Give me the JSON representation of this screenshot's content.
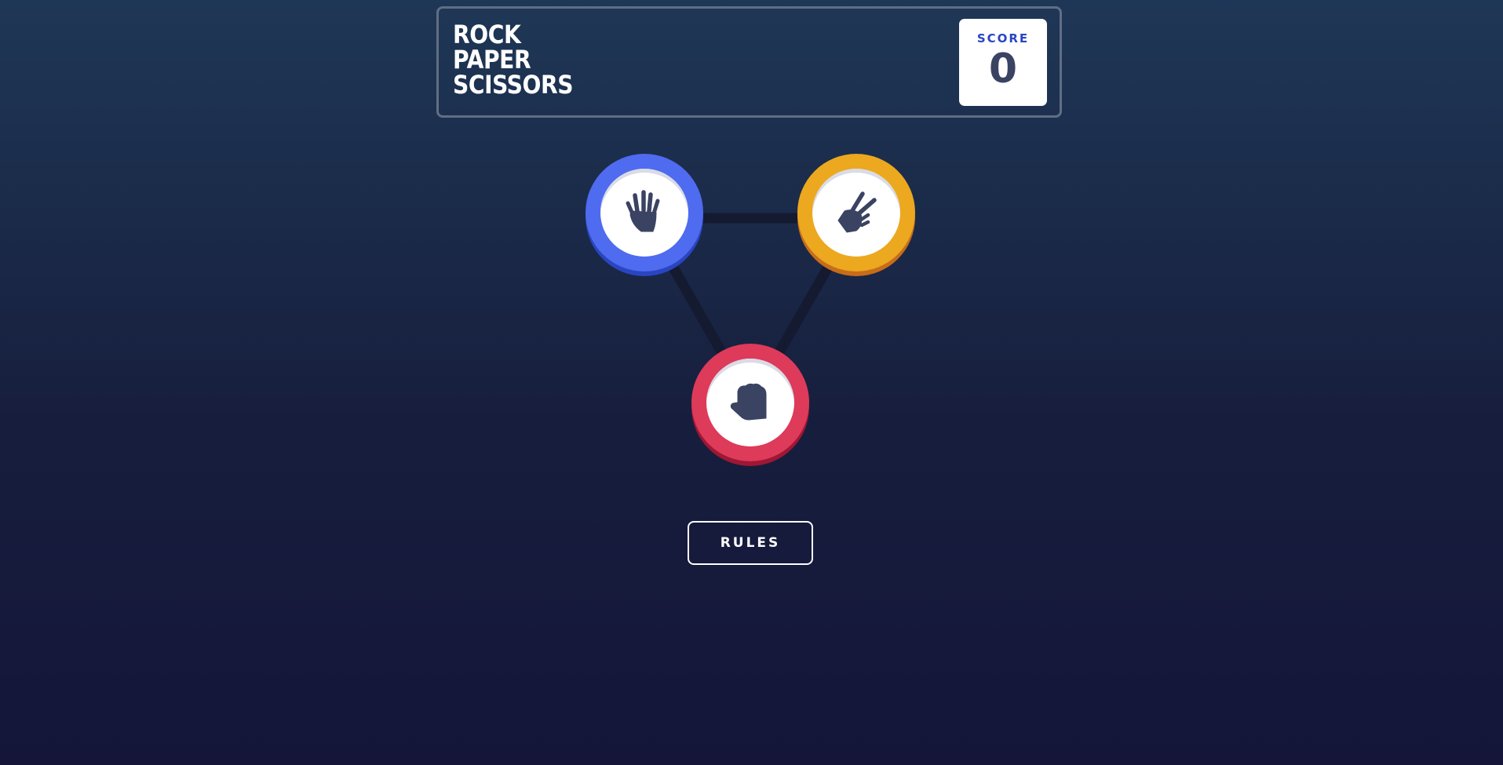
{
  "header": {
    "title_lines": [
      "ROCK",
      "PAPER",
      "SCISSORS"
    ]
  },
  "score": {
    "label": "SCORE",
    "value": "0"
  },
  "choices": [
    {
      "name": "paper",
      "icon": "paper-hand-icon",
      "ring_color": "#4f6bf0"
    },
    {
      "name": "scissors",
      "icon": "scissors-hand-icon",
      "ring_color": "#eca81e"
    },
    {
      "name": "rock",
      "icon": "rock-fist-icon",
      "ring_color": "#de3a5a"
    }
  ],
  "rules_button": {
    "label": "RULES"
  },
  "colors": {
    "background_top": "#1f3756",
    "background_bottom": "#141539",
    "header_outline": "#606e85",
    "score_label": "#2a45c2",
    "score_value": "#3b4363",
    "icon": "#3b4363",
    "triangle": "#141a30"
  }
}
